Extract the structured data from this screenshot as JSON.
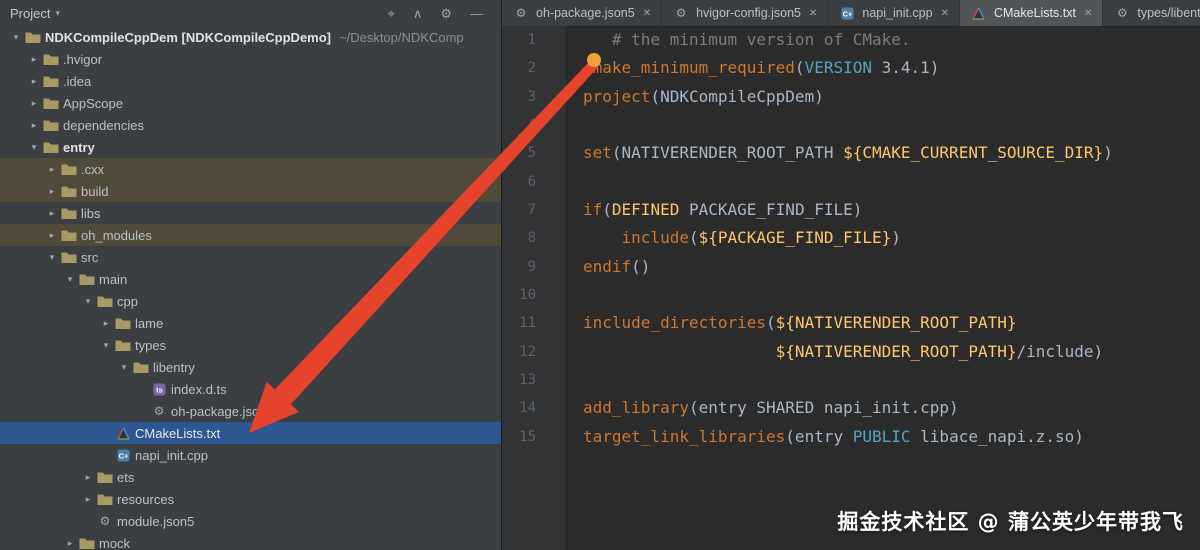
{
  "project_panel": {
    "header": {
      "title": "Project",
      "caret": "▾",
      "actions": [
        {
          "name": "locate-file",
          "glyph": "⌖"
        },
        {
          "name": "collapse-all",
          "glyph": "∧"
        },
        {
          "name": "settings",
          "glyph": "⚙"
        },
        {
          "name": "hide-panel",
          "glyph": "—"
        }
      ]
    },
    "tree": [
      {
        "label": "NDKCompileCppDem [NDKCompileCppDemo]",
        "suffix": "~/Desktop/NDKComp",
        "level": 0,
        "chevron": "down",
        "icon": "folder",
        "bold": true,
        "row": "normal"
      },
      {
        "label": ".hvigor",
        "level": 1,
        "chevron": "right",
        "icon": "folder",
        "row": "normal"
      },
      {
        "label": ".idea",
        "level": 1,
        "chevron": "right",
        "icon": "folder",
        "row": "normal"
      },
      {
        "label": "AppScope",
        "level": 1,
        "chevron": "right",
        "icon": "folder",
        "row": "normal"
      },
      {
        "label": "dependencies",
        "level": 1,
        "chevron": "right",
        "icon": "folder",
        "row": "normal"
      },
      {
        "label": "entry",
        "level": 1,
        "chevron": "down",
        "icon": "folder",
        "bold": true,
        "row": "normal"
      },
      {
        "label": ".cxx",
        "level": 2,
        "chevron": "right",
        "icon": "folder",
        "row": "modified"
      },
      {
        "label": "build",
        "level": 2,
        "chevron": "right",
        "icon": "folder",
        "row": "modified"
      },
      {
        "label": "libs",
        "level": 2,
        "chevron": "right",
        "icon": "folder",
        "row": "normal"
      },
      {
        "label": "oh_modules",
        "level": 2,
        "chevron": "right",
        "icon": "folder",
        "row": "modified"
      },
      {
        "label": "src",
        "level": 2,
        "chevron": "down",
        "icon": "folder",
        "row": "normal"
      },
      {
        "label": "main",
        "level": 3,
        "chevron": "down",
        "icon": "folder",
        "row": "normal"
      },
      {
        "label": "cpp",
        "level": 4,
        "chevron": "down",
        "icon": "folder",
        "row": "normal"
      },
      {
        "label": "lame",
        "level": 5,
        "chevron": "right",
        "icon": "folder",
        "row": "normal"
      },
      {
        "label": "types",
        "level": 5,
        "chevron": "down",
        "icon": "folder",
        "row": "normal"
      },
      {
        "label": "libentry",
        "level": 6,
        "chevron": "down",
        "icon": "folder",
        "row": "normal"
      },
      {
        "label": "index.d.ts",
        "level": 7,
        "chevron": "none",
        "icon": "ts",
        "row": "normal"
      },
      {
        "label": "oh-package.json5",
        "level": 7,
        "chevron": "none",
        "icon": "json5",
        "row": "normal"
      },
      {
        "label": "CMakeLists.txt",
        "level": 5,
        "chevron": "none",
        "icon": "cmake",
        "row": "selected"
      },
      {
        "label": "napi_init.cpp",
        "level": 5,
        "chevron": "none",
        "icon": "cpp",
        "row": "normal"
      },
      {
        "label": "ets",
        "level": 4,
        "chevron": "right",
        "icon": "folder",
        "row": "normal"
      },
      {
        "label": "resources",
        "level": 4,
        "chevron": "right",
        "icon": "folder",
        "row": "normal"
      },
      {
        "label": "module.json5",
        "level": 4,
        "chevron": "none",
        "icon": "json5",
        "row": "normal"
      },
      {
        "label": "mock",
        "level": 3,
        "chevron": "right",
        "icon": "folder",
        "row": "normal"
      }
    ]
  },
  "editor": {
    "close_glyph": "✕",
    "tabs": [
      {
        "label": "oh-package.json5",
        "icon": "json5",
        "active": false
      },
      {
        "label": "hvigor-config.json5",
        "icon": "json5",
        "active": false
      },
      {
        "label": "napi_init.cpp",
        "icon": "cpp",
        "active": false
      },
      {
        "label": "CMakeLists.txt",
        "icon": "cmake",
        "active": true
      },
      {
        "label": "types/libentry/oh-p",
        "icon": "json5",
        "active": false
      }
    ],
    "lines": [
      {
        "num": "1",
        "tokens": [
          [
            "plain",
            "   "
          ],
          [
            "comment",
            "# the minimum version of CMake."
          ]
        ]
      },
      {
        "num": "2",
        "tokens": [
          [
            "cmd",
            "cmake_minimum_required"
          ],
          [
            "plain",
            "("
          ],
          [
            "kw",
            "VERSION"
          ],
          [
            "plain",
            " 3.4.1)"
          ]
        ]
      },
      {
        "num": "3",
        "tokens": [
          [
            "cmd",
            "project"
          ],
          [
            "plain",
            "(NDKCompileCppDem)"
          ]
        ]
      },
      {
        "num": "4",
        "tokens": []
      },
      {
        "num": "5",
        "tokens": [
          [
            "cmd",
            "set"
          ],
          [
            "plain",
            "(NATIVERENDER_ROOT_PATH "
          ],
          [
            "var",
            "${CMAKE_CURRENT_SOURCE_DIR}"
          ],
          [
            "plain",
            ")"
          ]
        ]
      },
      {
        "num": "6",
        "tokens": []
      },
      {
        "num": "7",
        "tokens": [
          [
            "cmd",
            "if"
          ],
          [
            "plain",
            "("
          ],
          [
            "var",
            "DEFINED"
          ],
          [
            "plain",
            " PACKAGE_FIND_FILE)"
          ]
        ]
      },
      {
        "num": "8",
        "tokens": [
          [
            "plain",
            "    "
          ],
          [
            "cmd",
            "include"
          ],
          [
            "plain",
            "("
          ],
          [
            "var",
            "${PACKAGE_FIND_FILE}"
          ],
          [
            "plain",
            ")"
          ]
        ]
      },
      {
        "num": "9",
        "tokens": [
          [
            "cmd",
            "endif"
          ],
          [
            "plain",
            "()"
          ]
        ]
      },
      {
        "num": "10",
        "tokens": []
      },
      {
        "num": "11",
        "tokens": [
          [
            "cmd",
            "include_directories"
          ],
          [
            "plain",
            "("
          ],
          [
            "var",
            "${NATIVERENDER_ROOT_PATH}"
          ]
        ]
      },
      {
        "num": "12",
        "tokens": [
          [
            "plain",
            "                    "
          ],
          [
            "var",
            "${NATIVERENDER_ROOT_PATH}"
          ],
          [
            "plain",
            "/include)"
          ]
        ]
      },
      {
        "num": "13",
        "tokens": []
      },
      {
        "num": "14",
        "tokens": [
          [
            "cmd",
            "add_library"
          ],
          [
            "plain",
            "(entry SHARED napi_init.cpp)"
          ]
        ]
      },
      {
        "num": "15",
        "tokens": [
          [
            "cmd",
            "target_link_libraries"
          ],
          [
            "plain",
            "(entry "
          ],
          [
            "kw",
            "PUBLIC"
          ],
          [
            "plain",
            " libace_napi.z.so)"
          ]
        ]
      }
    ]
  },
  "overlay": {
    "watermark": "掘金技术社区 @ 蒲公英少年带我飞"
  },
  "colors": {
    "panel_bg": "#3c3f41",
    "editor_bg": "#2b2b2b",
    "selection_blue": "#2c5791",
    "modified_row_olive": "#4f4a39",
    "arrow_red": "#e5432b",
    "dot_orange": "#f0a23a",
    "command_orange": "#cc7832",
    "variable_yellow": "#ffc66d",
    "keyword_cyan": "#55a5c0",
    "comment_gray": "#7d7d7d"
  }
}
